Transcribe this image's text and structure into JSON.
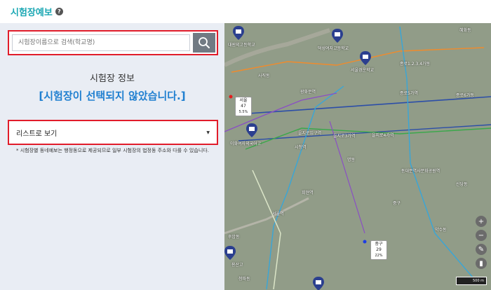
{
  "header": {
    "title": "시험장예보",
    "help_icon": "?"
  },
  "search": {
    "placeholder": "시험장이름으로 검색(학교명)"
  },
  "info": {
    "title": "시험장 정보",
    "message": "[시험장이 선택되지 않았습니다.]"
  },
  "view_select": {
    "selected": "리스트로 보기"
  },
  "note": "* 시험장별 동네예보는 행정동으로 제공되므로 일부 시험장의 법정동 주소와 다를 수 있습니다.",
  "map": {
    "labels": [
      "대원외고등학교",
      "덕성여자고등학교",
      "서울경운학교",
      "종로1.2.3.4가동",
      "사직동",
      "광화문역",
      "종로5가역",
      "종로6가동",
      "을지로입구역",
      "을지로3가역",
      "을지로4가역",
      "동대문역사문화공원역",
      "시청역",
      "이화여자외국어고",
      "회현역",
      "서울역",
      "명동",
      "중구",
      "약수동",
      "후암동",
      "신당동",
      "청파동",
      "용산고",
      "혜화동"
    ],
    "weather": [
      {
        "name": "서울",
        "temp": "47",
        "detail": "5.5%"
      },
      {
        "name": "중구",
        "temp": "29",
        "detail": "22%"
      }
    ],
    "scale": "500 m",
    "colors": {
      "line1": "#2c4ea8",
      "line2": "#3aa84a",
      "line3": "#f08b2c",
      "line4": "#38a6d8",
      "line5": "#8a4fc4"
    }
  }
}
